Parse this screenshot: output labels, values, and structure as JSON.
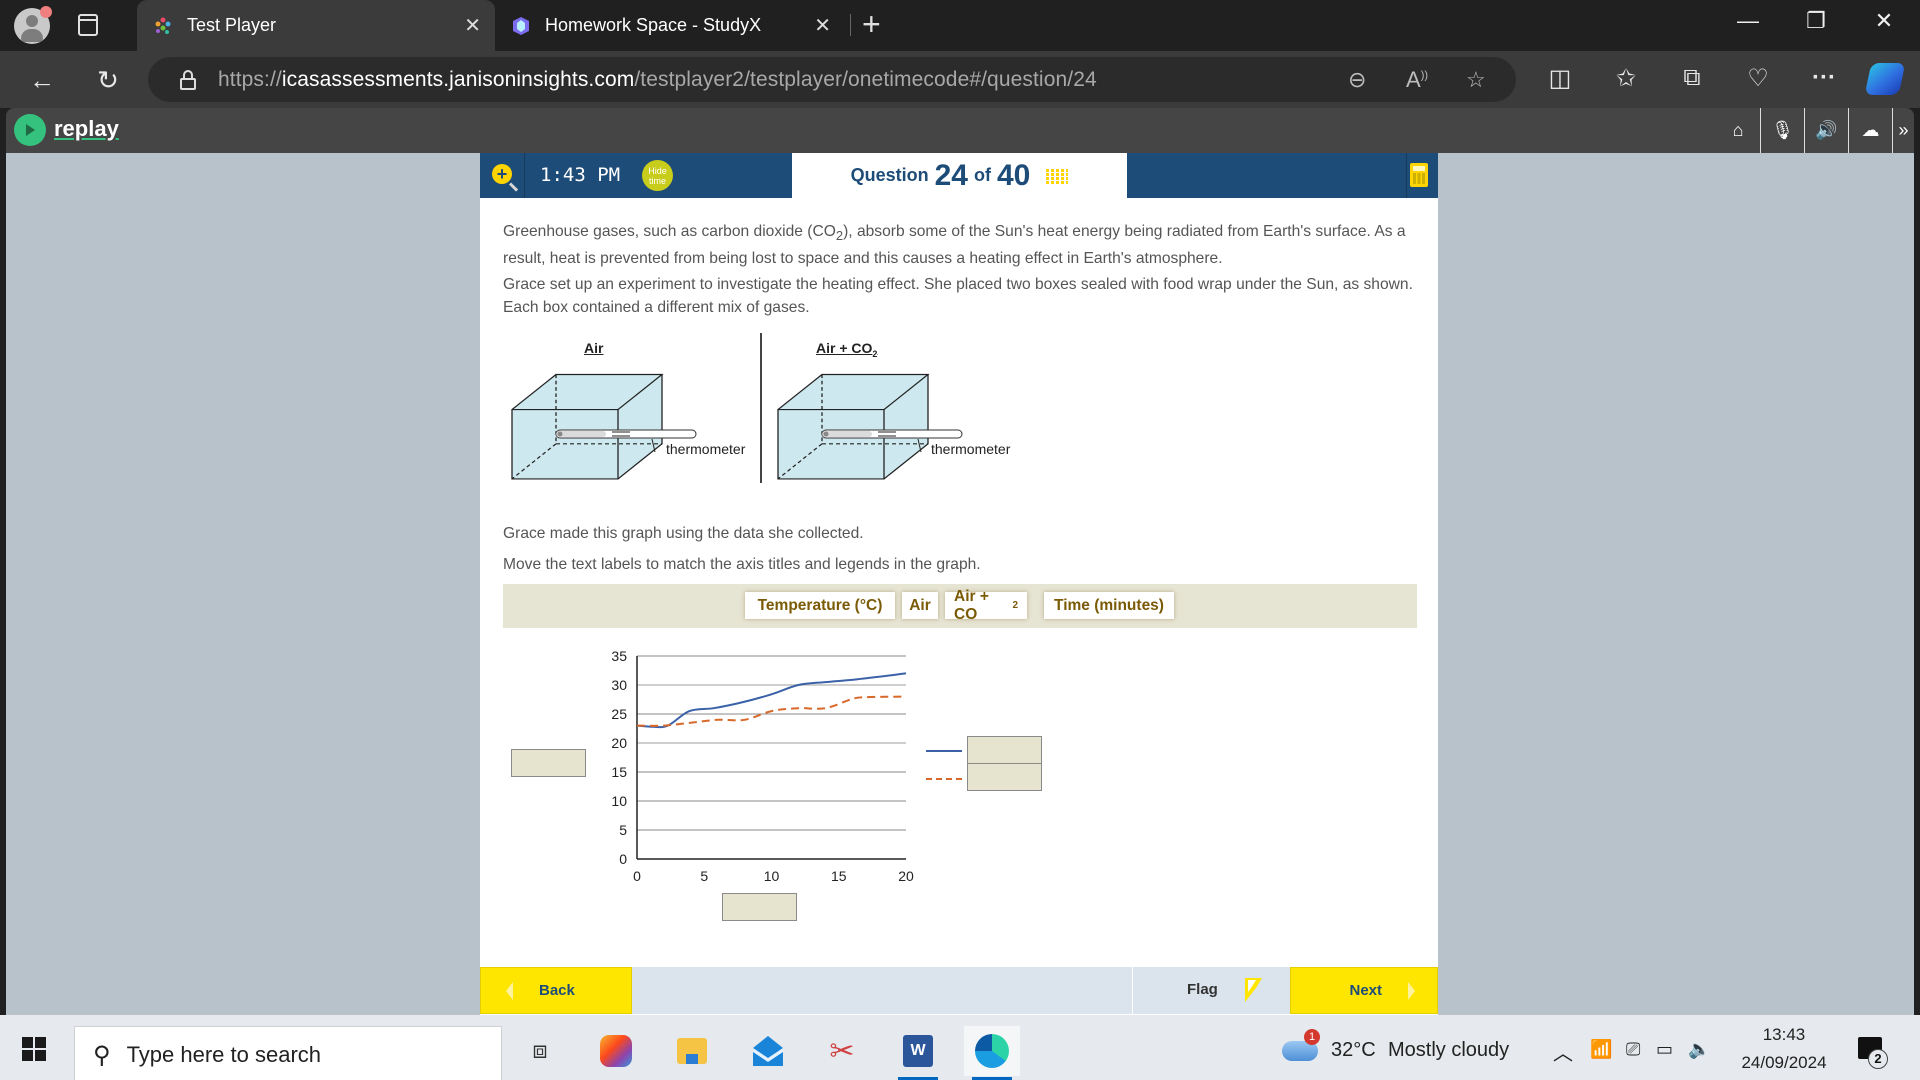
{
  "browser": {
    "tabs": [
      {
        "title": "Test Player",
        "active": true
      },
      {
        "title": "Homework Space - StudyX",
        "active": false
      }
    ],
    "url": {
      "scheme": "https://",
      "host": "icasassessments.janisoninsights.com",
      "path": "/testplayer2/testplayer/onetimecode#/question/24"
    }
  },
  "replay": {
    "brand": "replay",
    "icons": [
      "home-icon",
      "microphone-icon",
      "speaker-icon",
      "cloud-icon",
      "expand-icon"
    ]
  },
  "question_header": {
    "time": "1:43 PM",
    "hide_time_label": "Hide time",
    "question_label": "Question",
    "question_number": "24",
    "of_label": "of",
    "total_questions": "40"
  },
  "question": {
    "intro": [
      {
        "before": "Greenhouse gases, such as carbon dioxide (CO",
        "sub": "2",
        "after": "), absorb some of the Sun's heat energy being radiated from Earth's surface. As a result, heat is prevented from being lost to space and this causes a heating effect in Earth's atmosphere."
      },
      {
        "text": "Grace set up an experiment to investigate the heating effect. She placed two boxes sealed with food wrap under the Sun, as shown. Each box contained a different mix of gases."
      }
    ],
    "diagram": {
      "left_label": "Air",
      "right_label": "Air + CO",
      "right_label_sub": "2",
      "thermometer_label": "thermometer"
    },
    "graph_intro": "Grace made this graph using the data she collected.",
    "instruction": "Move the text labels to match the axis titles and legends in the graph.",
    "drag_labels": [
      {
        "text": "Temperature (°C)"
      },
      {
        "text": "Air"
      },
      {
        "text": "Air + CO",
        "sub": "2"
      },
      {
        "text": "Time (minutes)"
      }
    ]
  },
  "chart_data": {
    "type": "line",
    "title": "",
    "xlabel": "",
    "ylabel": "",
    "xlim": [
      0,
      20
    ],
    "ylim": [
      0,
      35
    ],
    "xticks": [
      0,
      5,
      10,
      15,
      20
    ],
    "yticks": [
      0,
      5,
      10,
      15,
      20,
      25,
      30,
      35
    ],
    "grid": "horizontal",
    "legend": "right",
    "series": [
      {
        "name": "",
        "style": "solid",
        "color": "#3b62a8",
        "x": [
          0,
          1.2,
          2.3,
          3.9,
          5.7,
          7.8,
          10,
          12,
          14,
          16.4,
          20
        ],
        "y": [
          23,
          22.8,
          23,
          25.5,
          26,
          27,
          28.4,
          30,
          30.5,
          31,
          32
        ]
      },
      {
        "name": "",
        "style": "dashed",
        "color": "#d9692a",
        "x": [
          0,
          2,
          4,
          6,
          8,
          10,
          12,
          14,
          16,
          17,
          20
        ],
        "y": [
          23,
          23,
          23.5,
          24,
          24,
          25.5,
          26,
          26,
          27.6,
          27.9,
          28
        ]
      }
    ]
  },
  "footer": {
    "back_label": "Back",
    "flag_label": "Flag",
    "next_label": "Next"
  },
  "taskbar": {
    "search_placeholder": "Type here to search",
    "weather_temp": "32°C",
    "weather_text": "Mostly cloudy",
    "weather_badge": "1",
    "time": "13:43",
    "date": "24/09/2024",
    "notification_count": "2"
  }
}
